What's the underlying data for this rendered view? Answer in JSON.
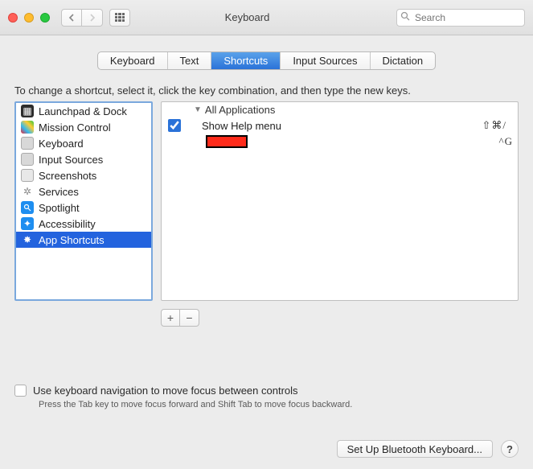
{
  "titlebar": {
    "title": "Keyboard",
    "search_placeholder": "Search"
  },
  "tabs": {
    "keyboard": "Keyboard",
    "text": "Text",
    "shortcuts": "Shortcuts",
    "input_sources": "Input Sources",
    "dictation": "Dictation"
  },
  "instruction": "To change a shortcut, select it, click the key combination, and then type the new keys.",
  "categories": {
    "launchpad": "Launchpad & Dock",
    "mission": "Mission Control",
    "keyboard": "Keyboard",
    "input": "Input Sources",
    "screenshots": "Screenshots",
    "services": "Services",
    "spotlight": "Spotlight",
    "accessibility": "Accessibility",
    "app_shortcuts": "App Shortcuts"
  },
  "right": {
    "all_apps": "All Applications",
    "items": [
      {
        "label": "Show Help menu",
        "shortcut": "⇧⌘/"
      },
      {
        "label": "",
        "shortcut": "^G"
      }
    ]
  },
  "kbnav": {
    "label": "Use keyboard navigation to move focus between controls",
    "sub": "Press the Tab key to move focus forward and Shift Tab to move focus backward."
  },
  "footer": {
    "bluetooth": "Set Up Bluetooth Keyboard...",
    "help": "?"
  }
}
